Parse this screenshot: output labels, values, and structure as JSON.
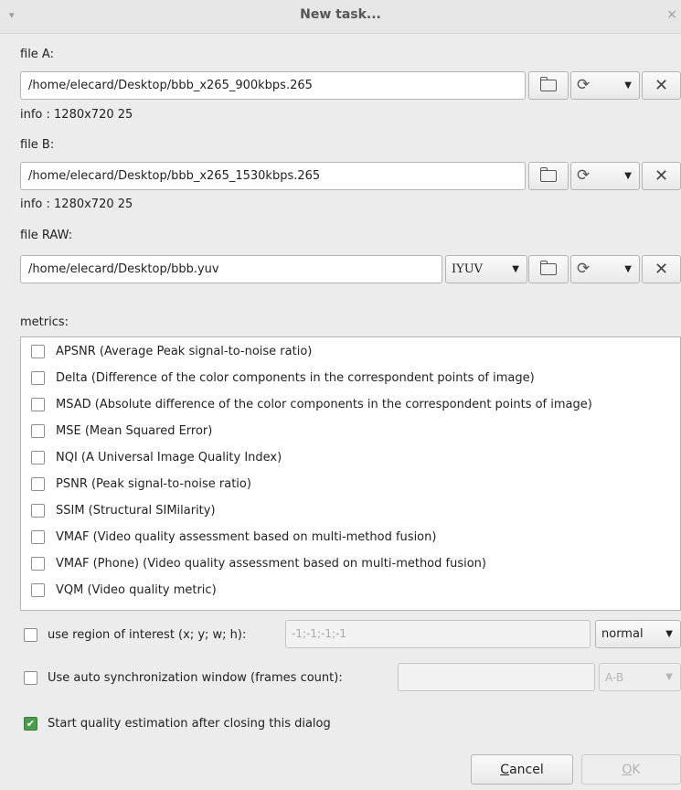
{
  "window": {
    "title": "New task...",
    "menu_glyph": "▾",
    "close_glyph": "×"
  },
  "file_a": {
    "label": "file A:",
    "path": "/home/elecard/Desktop/bbb_x265_900kbps.265",
    "info": "info : 1280x720 25"
  },
  "file_b": {
    "label": "file B:",
    "path": "/home/elecard/Desktop/bbb_x265_1530kbps.265",
    "info": "info : 1280x720 25"
  },
  "file_raw": {
    "label": "file RAW:",
    "path": "/home/elecard/Desktop/bbb.yuv",
    "format": "IYUV"
  },
  "glyphs": {
    "reload": "⟳",
    "caret": "▼",
    "close": "✕",
    "check": "✔"
  },
  "metrics": {
    "label": "metrics:",
    "items": [
      {
        "label": "APSNR (Average Peak signal-to-noise ratio)",
        "checked": false
      },
      {
        "label": "Delta (Difference of the color components in the correspondent points of image)",
        "checked": false
      },
      {
        "label": "MSAD (Absolute difference of the color components in the correspondent points of image)",
        "checked": false
      },
      {
        "label": "MSE (Mean Squared Error)",
        "checked": false
      },
      {
        "label": "NQI (A Universal Image Quality Index)",
        "checked": false
      },
      {
        "label": "PSNR (Peak signal-to-noise ratio)",
        "checked": false
      },
      {
        "label": "SSIM (Structural SIMilarity)",
        "checked": false
      },
      {
        "label": "VMAF (Video quality assessment based on multi-method fusion)",
        "checked": false
      },
      {
        "label": "VMAF (Phone) (Video quality assessment based on multi-method fusion)",
        "checked": false
      },
      {
        "label": "VQM (Video quality metric)",
        "checked": false
      }
    ]
  },
  "roi": {
    "label": "use region of interest  (x; y; w; h):",
    "placeholder": "-1;-1;-1;-1",
    "mode": "normal",
    "checked": false
  },
  "sync": {
    "label": "Use auto synchronization window (frames count):",
    "value": "",
    "mode": "A-B",
    "checked": false
  },
  "start_after": {
    "label": "Start quality estimation after closing this dialog",
    "checked": true
  },
  "buttons": {
    "cancel_mnemonic": "C",
    "cancel_rest": "ancel",
    "ok_mnemonic": "O",
    "ok_rest": "K"
  }
}
